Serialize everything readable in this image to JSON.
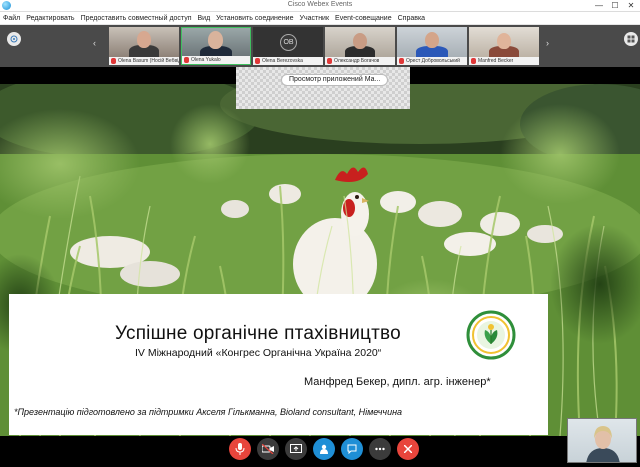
{
  "window": {
    "title": "Cisco Webex Events",
    "minimize": "—",
    "maximize": "☐",
    "close": "✕"
  },
  "menu": [
    "Файл",
    "Редактировать",
    "Предоставить совместный доступ",
    "Вид",
    "Установить соединение",
    "Участник",
    "Event-совещание",
    "Справка"
  ],
  "participants": [
    {
      "name": "Olena Basum (Носій Вебвідео)",
      "initials": ""
    },
    {
      "name": "Olena Yukalo",
      "initials": ""
    },
    {
      "name": "Olena Berezovska",
      "initials": "OB"
    },
    {
      "name": "Олександр Богачов",
      "initials": ""
    },
    {
      "name": "Орест Добровольський",
      "initials": ""
    },
    {
      "name": "Manfred Becker",
      "initials": ""
    }
  ],
  "share_label": "Просмотр приложений Ма...",
  "slide": {
    "title": "Успішне органічне птахівництво",
    "subtitle": "IV Міжнародний «Конгрес Органічна Україна 2020“",
    "author": "Манфред Бекер, дипл. агр. інженер*",
    "note": "*Презентацію підготовлено за підтримки Акселя Гількманна, Bioland consultant, Німеччина"
  },
  "controls": [
    {
      "name": "mute-button",
      "icon": "microphone-icon",
      "color": "#e8453c"
    },
    {
      "name": "video-button",
      "icon": "video-off-icon",
      "color": "#3b3b3b"
    },
    {
      "name": "share-button",
      "icon": "share-icon",
      "color": "#3b3b3b"
    },
    {
      "name": "participants-button",
      "icon": "participants-icon",
      "color": "#1f8fd6"
    },
    {
      "name": "chat-button",
      "icon": "chat-icon",
      "color": "#1f8fd6"
    },
    {
      "name": "more-button",
      "icon": "more-icon",
      "color": "#3b3b3b"
    },
    {
      "name": "leave-button",
      "icon": "close-icon",
      "color": "#e8453c"
    }
  ],
  "colors": {
    "accent_blue": "#1f8fd6",
    "danger_red": "#e8453c",
    "strip_bg": "#4a4a4a"
  }
}
